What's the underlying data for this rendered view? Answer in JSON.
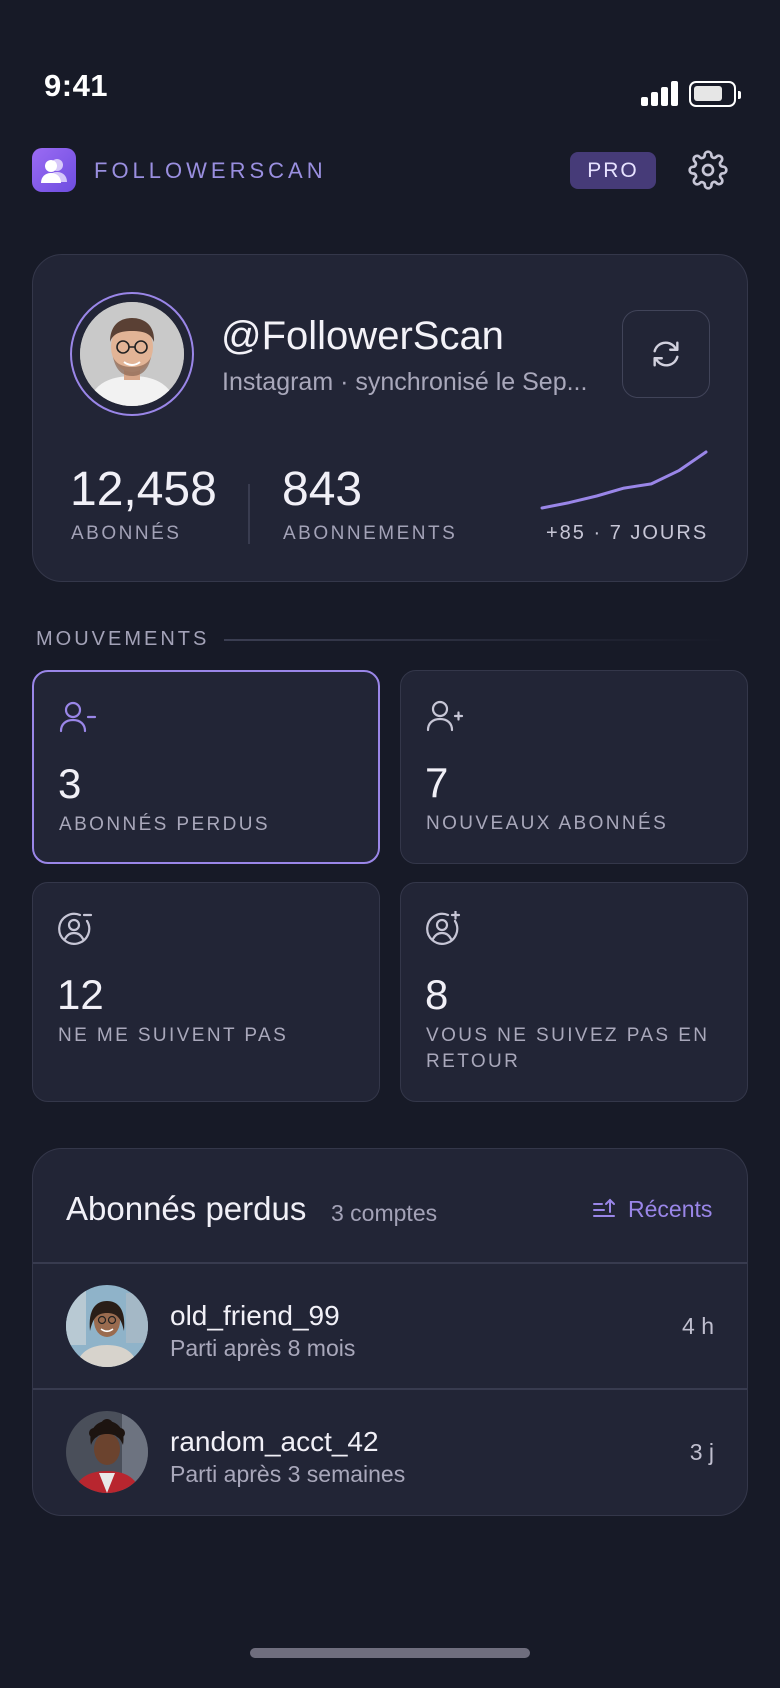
{
  "status_bar": {
    "time": "9:41"
  },
  "header": {
    "brand": "FOLLOWERSCAN",
    "badge": "PRO"
  },
  "profile": {
    "handle": "@FollowerScan",
    "subtitle": "Instagram · synchronisé le Sep...",
    "followers": {
      "value": "12,458",
      "label": "ABONNÉS"
    },
    "following": {
      "value": "843",
      "label": "ABONNEMENTS"
    },
    "trend": "+85 · 7 JOURS",
    "sparkline": [
      0,
      9,
      20,
      33,
      40,
      62,
      93
    ]
  },
  "movements": {
    "title": "MOUVEMENTS",
    "tiles": [
      {
        "value": "3",
        "label": "ABONNÉS PERDUS",
        "icon": "user-minus-icon"
      },
      {
        "value": "7",
        "label": "NOUVEAUX ABONNÉS",
        "icon": "user-plus-icon"
      },
      {
        "value": "12",
        "label": "NE ME SUIVENT PAS",
        "icon": "user-circle-minus-icon"
      },
      {
        "value": "8",
        "label": "VOUS NE SUIVEZ PAS EN RETOUR",
        "icon": "user-circle-plus-icon"
      }
    ]
  },
  "lost_list": {
    "title": "Abonnés perdus",
    "count": "3 comptes",
    "sort_label": "Récents",
    "rows": [
      {
        "name": "old_friend_99",
        "detail": "Parti après 8 mois",
        "time": "4 h"
      },
      {
        "name": "random_acct_42",
        "detail": "Parti après 3 semaines",
        "time": "3 j"
      }
    ]
  },
  "colors": {
    "accent": "#9a86e8",
    "background": "#171a27",
    "card": "#222536"
  }
}
